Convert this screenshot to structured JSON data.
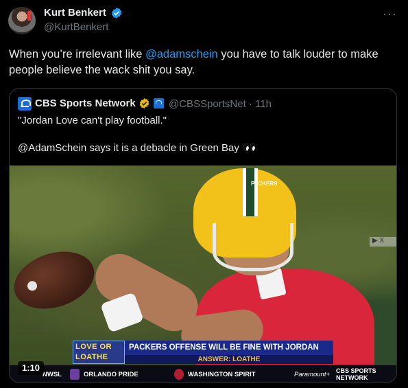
{
  "author": {
    "display_name": "Kurt Benkert",
    "handle": "@KurtBenkert"
  },
  "tweet": {
    "text_before": "When you’re irrelevant like ",
    "mention": "@adamschein",
    "text_after": " you have to talk louder to make people believe the wack shit you say."
  },
  "more_icon": "···",
  "quoted": {
    "display_name": "CBS Sports Network",
    "handle_time": "@CBSSportsNet · 11h",
    "line1": "\"Jordan Love can't play football.\"",
    "line2": "@AdamSchein says it is a debacle in Green Bay",
    "media": {
      "ad_badge": "▶ X",
      "graphic_logo": "LOVE OR LOATHE",
      "headline": "PACKERS OFFENSE WILL BE FINE WITH JORDAN LOVE",
      "answer": "ANSWER: LOATHE",
      "jersey_tag": "PACKERS",
      "ticker": [
        "NWSL",
        "ORLANDO PRIDE",
        "WASHINGTON SPIRIT",
        "Paramount+",
        "CBS SPORTS NETWORK"
      ],
      "duration": "1:10"
    }
  },
  "colors": {
    "background": "#000000",
    "text": "#e7e9ea",
    "secondary": "#71767b",
    "link": "#1d9bf0",
    "border": "#2f3336"
  }
}
